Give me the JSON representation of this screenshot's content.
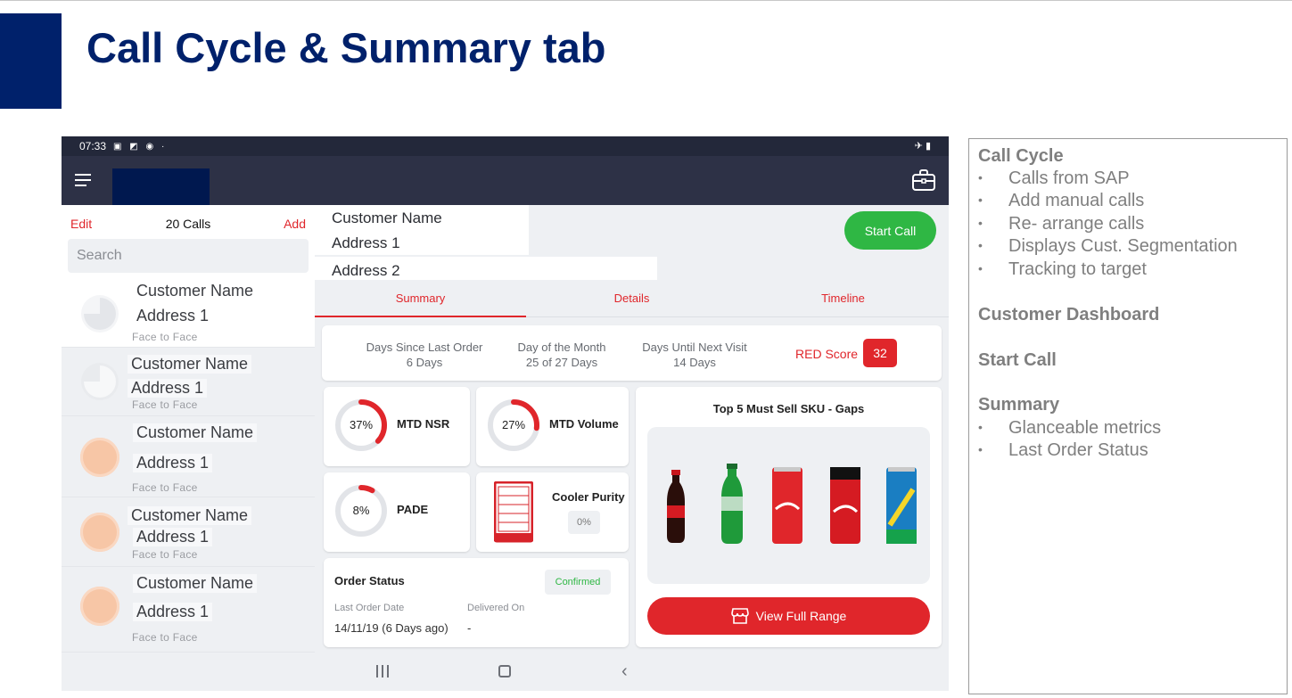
{
  "slide": {
    "title": "Call Cycle & Summary tab"
  },
  "status_bar": {
    "time": "07:33",
    "sys_icons": "▣ ◩ ◉ ·",
    "right_icons": "✈ ▮"
  },
  "app_bar": {
    "menu_icon": "hamburger-icon",
    "briefcase_icon": "briefcase-icon"
  },
  "call_list": {
    "edit_label": "Edit",
    "calls_count": "20 Calls",
    "add_label": "Add",
    "search_placeholder": "Search",
    "items": [
      {
        "name": "Customer Name",
        "address": "Address 1",
        "type": "Face to Face"
      },
      {
        "name": "Customer Name",
        "address": "Address 1",
        "type": "Face to Face"
      },
      {
        "name": "Customer Name",
        "address": "Address 1",
        "type": "Face to Face"
      },
      {
        "name": "Customer Name",
        "address": "Address 1",
        "type": "Face to Face"
      },
      {
        "name": "Customer Name",
        "address": "Address 1",
        "type": "Face to Face"
      }
    ]
  },
  "customer": {
    "name": "Customer Name",
    "address1": "Address 1",
    "address2": "Address 2",
    "start_call_label": "Start Call"
  },
  "tabs": [
    {
      "label": "Summary",
      "active": true
    },
    {
      "label": "Details",
      "active": false
    },
    {
      "label": "Timeline",
      "active": false
    }
  ],
  "metrics": {
    "days_since_last_order": {
      "label": "Days Since Last Order",
      "value": "6 Days"
    },
    "day_of_month": {
      "label": "Day of the Month",
      "value": "25 of 27 Days"
    },
    "days_until_next_visit": {
      "label": "Days Until Next Visit",
      "value": "14 Days"
    },
    "red_score": {
      "label": "RED Score",
      "value": "32"
    }
  },
  "kpis": [
    {
      "name": "MTD NSR",
      "percent_label": "37%",
      "percent": 37
    },
    {
      "name": "MTD Volume",
      "percent_label": "27%",
      "percent": 27
    },
    {
      "name": "PADE",
      "percent_label": "8%",
      "percent": 8
    }
  ],
  "cooler": {
    "name": "Cooler Purity",
    "value": "0%"
  },
  "order_status": {
    "title": "Order Status",
    "status": "Confirmed",
    "last_order_label": "Last Order Date",
    "last_order_value": "14/11/19 (6 Days ago)",
    "delivered_label": "Delivered On",
    "delivered_value": "-"
  },
  "sku": {
    "title": "Top 5 Must Sell SKU - Gaps",
    "view_range_label": "View Full Range",
    "products": [
      "coca-cola-bottle",
      "sprite-bottle",
      "coca-cola-can",
      "coca-cola-zero-can",
      "sprite-can"
    ]
  },
  "colors": {
    "navy": "#00216b",
    "red": "#e0262b",
    "green": "#2fb744",
    "ring_track": "#e2e4e8"
  },
  "notes": {
    "call_cycle": {
      "heading": "Call Cycle",
      "items": [
        "Calls from SAP",
        "Add manual calls",
        "Re- arrange calls",
        "Displays Cust. Segmentation",
        "Tracking to target"
      ]
    },
    "customer_dashboard": {
      "heading": "Customer Dashboard"
    },
    "start_call": {
      "heading": "Start Call"
    },
    "summary": {
      "heading": "Summary",
      "items": [
        "Glanceable metrics",
        "Last Order Status"
      ]
    },
    "bullet": "•"
  }
}
